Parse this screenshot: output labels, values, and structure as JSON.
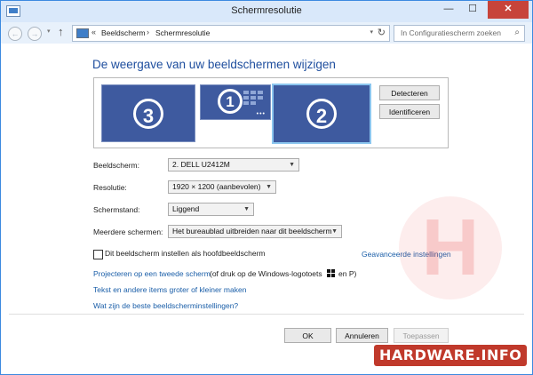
{
  "window": {
    "title": "Schermresolutie",
    "controls": {
      "minimize": "—",
      "maximize": "☐",
      "close": "✕"
    }
  },
  "nav": {
    "back_icon": "arrow-left-icon",
    "forward_icon": "arrow-right-icon",
    "up_icon": "arrow-up-icon",
    "breadcrumb_prefix": "«",
    "breadcrumb": [
      "Beeldscherm",
      "Schermresolutie"
    ],
    "separator": "›",
    "search_placeholder": "In Configuratiescherm zoeken"
  },
  "heading": "De weergave van uw beeldschermen wijzigen",
  "monitors": [
    {
      "number": "3"
    },
    {
      "number": "1"
    },
    {
      "number": "2"
    }
  ],
  "buttons": {
    "detect": "Detecteren",
    "identify": "Identificeren",
    "ok": "OK",
    "cancel": "Annuleren",
    "apply": "Toepassen"
  },
  "fields": {
    "display": {
      "label": "Beeldscherm:",
      "value": "2. DELL U2412M"
    },
    "resolution": {
      "label": "Resolutie:",
      "value": "1920 × 1200 (aanbevolen)"
    },
    "orientation": {
      "label": "Schermstand:",
      "value": "Liggend"
    },
    "multiple": {
      "label": "Meerdere schermen:",
      "value": "Het bureaublad uitbreiden naar dit beeldscherm"
    }
  },
  "checkbox": {
    "label": "Dit beeldscherm instellen als hoofdbeeldscherm",
    "checked": false
  },
  "links": {
    "advanced": "Geavanceerde instellingen",
    "project": "Projecteren op een tweede scherm",
    "project_suffix": "(of druk op de Windows-logotoets",
    "project_end": "en P)",
    "text_size": "Tekst en andere items groter of kleiner maken",
    "best_settings": "Wat zijn de beste beeldscherminstellingen?"
  },
  "watermark": "HARDWARE.INFO",
  "colors": {
    "accent": "#1e4e9e",
    "link": "#1a5ea8",
    "monitor": "#3e5a9f",
    "selected_border": "#8cc6ef"
  }
}
